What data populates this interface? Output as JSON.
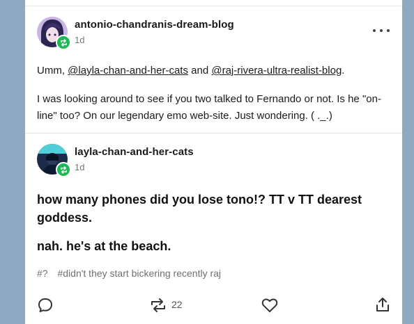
{
  "post1": {
    "username": "antonio-chandranis-dream-blog",
    "time": "1d",
    "para1_prefix": "Umm, ",
    "mention1": "@layla-chan-and-her-cats",
    "para1_mid": " and ",
    "mention2": "@raj-rivera-ultra-realist-blog",
    "para1_suffix": ".",
    "para2": "I was looking around to see if you two talked to Fernando or not. Is he \"on-line\" too? On our legendary emo web-site. Just wondering.  ( ._.)"
  },
  "post2": {
    "username": "layla-chan-and-her-cats",
    "time": "1d",
    "line1": "how many phones did you lose tono!?  TT v TT  dearest goddess.",
    "line2": "nah. he's at the beach."
  },
  "tags": [
    "#?",
    "#didn't they start bickering recently raj"
  ],
  "footer": {
    "reblog_count": "22"
  },
  "icons": {
    "more": "more-horizontal-icon",
    "reply": "comment-icon",
    "reblog": "reblog-icon",
    "like": "heart-icon",
    "share": "share-icon"
  },
  "colors": {
    "reblog_badge": "#1fb856",
    "page_bg": "#8fa9c2"
  }
}
